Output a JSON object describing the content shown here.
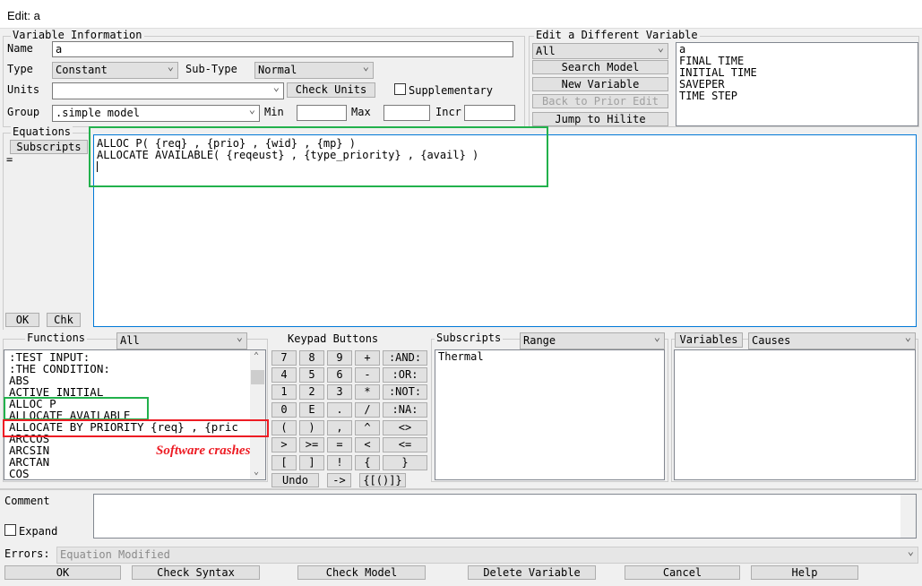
{
  "window": {
    "title": "Edit: a"
  },
  "variable_info": {
    "group_label": "Variable Information",
    "name_label": "Name",
    "name_value": "a",
    "type_label": "Type",
    "type_value": "Constant",
    "subtype_label": "Sub-Type",
    "subtype_value": "Normal",
    "units_label": "Units",
    "units_value": "",
    "check_units": "Check Units",
    "supplementary": "Supplementary",
    "supplementary_checked": false,
    "group_label2": "Group",
    "group_value": ".simple model",
    "min_label": "Min",
    "max_label": "Max",
    "incr_label": "Incr"
  },
  "edit_different": {
    "group_label": "Edit a Different Variable",
    "filter": "All",
    "search_model": "Search Model",
    "new_variable": "New Variable",
    "back_to_prior": "Back to Prior Edit",
    "jump_to_hilite": "Jump to Hilite",
    "variables": [
      "a",
      "FINAL TIME",
      "INITIAL TIME",
      "SAVEPER",
      "TIME STEP"
    ]
  },
  "equations": {
    "group_label": "Equations",
    "subscripts_button": "Subscripts",
    "equals": "=",
    "lines": [
      "ALLOC P( {req} , {prio} , {wid} , {mp} )",
      "ALLOCATE AVAILABLE( {reqeust} , {type_priority} , {avail} )"
    ],
    "ok": "OK",
    "chk": "Chk"
  },
  "functions": {
    "label": "Functions",
    "filter": "All",
    "items": [
      ":TEST INPUT:",
      ":THE CONDITION:",
      "ABS",
      "ACTIVE INITIAL",
      "ALLOC P",
      "ALLOCATE AVAILABLE",
      "ALLOCATE BY PRIORITY {req} , {pric",
      "ARCCOS",
      "ARCSIN",
      "ARCTAN",
      "COS"
    ],
    "annotation": "Software crashes",
    "highlight_colors": {
      "green": "#22b14c",
      "red": "#ed1c24"
    }
  },
  "keypad": {
    "label": "Keypad Buttons",
    "rows": [
      [
        "7",
        "8",
        "9",
        "+",
        ":AND:"
      ],
      [
        "4",
        "5",
        "6",
        "-",
        ":OR:"
      ],
      [
        "1",
        "2",
        "3",
        "*",
        ":NOT:"
      ],
      [
        "0",
        "E",
        ".",
        "/",
        ":NA:"
      ],
      [
        "(",
        ")",
        ",",
        "^",
        "<>"
      ],
      [
        ">",
        ">=",
        "=",
        "<",
        "<="
      ],
      [
        "[",
        "]",
        "!",
        "{",
        "}"
      ]
    ],
    "undo": "Undo",
    "arrow": "->",
    "brackets": "{[()]}"
  },
  "subscripts": {
    "label": "Subscripts",
    "filter": "Range",
    "items": [
      "Thermal"
    ]
  },
  "variables_panel": {
    "button": "Variables",
    "filter": "Causes"
  },
  "comment": {
    "label": "Comment",
    "expand": "Expand",
    "expand_checked": false
  },
  "errors": {
    "label": "Errors:",
    "value": "Equation Modified"
  },
  "footer": {
    "ok": "OK",
    "check_syntax": "Check Syntax",
    "check_model": "Check Model",
    "delete_variable": "Delete Variable",
    "cancel": "Cancel",
    "help": "Help"
  }
}
